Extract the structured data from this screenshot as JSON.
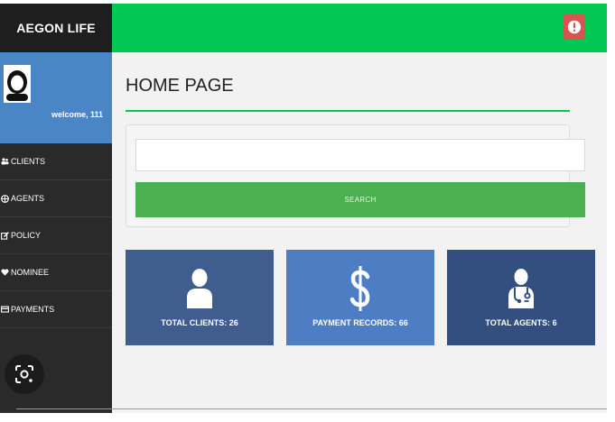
{
  "app": {
    "brand": "AEGON LIFE"
  },
  "profile": {
    "welcome": "welcome, 111"
  },
  "sidebar": {
    "items": [
      {
        "label": "CLIENTS",
        "icon": "users-icon"
      },
      {
        "label": "AGENTS",
        "icon": "globe-icon"
      },
      {
        "label": "POLICY",
        "icon": "edit-icon"
      },
      {
        "label": "NOMINEE",
        "icon": "heart-icon"
      },
      {
        "label": "PAYMENTS",
        "icon": "card-icon"
      }
    ]
  },
  "header": {
    "alert_icon": "exclamation-icon"
  },
  "main": {
    "title": "HOME PAGE",
    "search": {
      "placeholder": "",
      "button": "SEARCH"
    }
  },
  "cards": [
    {
      "label": "TOTAL CLIENTS: 26",
      "icon": "user-icon"
    },
    {
      "label": "PAYMENT RECORDS: 66",
      "icon": "dollar-icon"
    },
    {
      "label": "TOTAL AGENTS: 6",
      "icon": "doctor-icon"
    }
  ],
  "colors": {
    "topbar": "#00c853",
    "sidebar": "#2a2a2a",
    "profile": "#4a86c5",
    "search_button": "#4caf50",
    "card1": "#3f5d8f",
    "card2": "#4d7ec4",
    "card3": "#324f80",
    "alert": "#d9534f"
  }
}
